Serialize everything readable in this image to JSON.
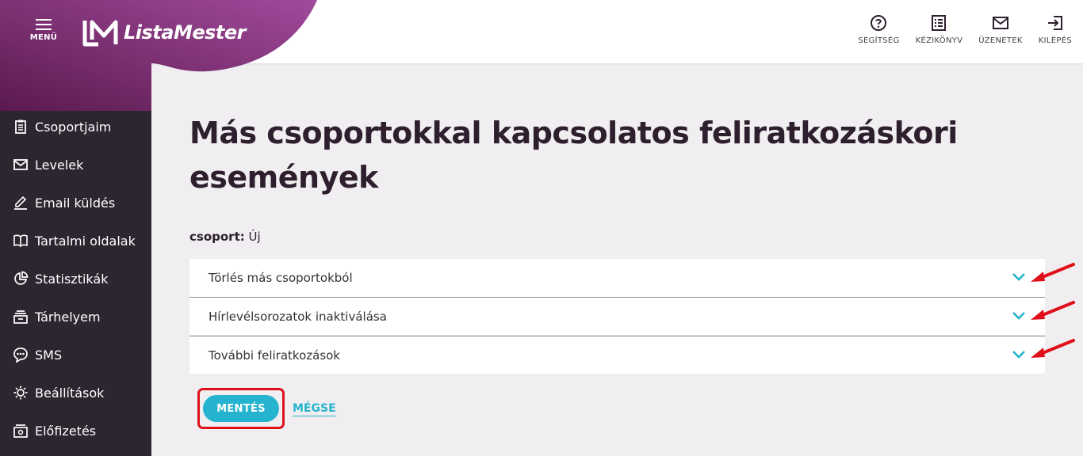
{
  "header": {
    "menu_label": "MENÜ",
    "logo_text": "ListaMester",
    "actions": [
      {
        "label": "SEGÍTSÉG",
        "icon": "help-icon"
      },
      {
        "label": "KÉZIKÖNYV",
        "icon": "manual-icon"
      },
      {
        "label": "ÜZENETEK",
        "icon": "mail-icon"
      },
      {
        "label": "KILÉPÉS",
        "icon": "logout-icon"
      }
    ]
  },
  "sidebar": {
    "items": [
      {
        "label": "Csoportjaim",
        "icon": "clipboard-icon"
      },
      {
        "label": "Levelek",
        "icon": "envelope-icon"
      },
      {
        "label": "Email küldés",
        "icon": "pencil-icon"
      },
      {
        "label": "Tartalmi oldalak",
        "icon": "book-icon"
      },
      {
        "label": "Statisztikák",
        "icon": "pie-chart-icon"
      },
      {
        "label": "Tárhelyem",
        "icon": "storage-icon"
      },
      {
        "label": "SMS",
        "icon": "sms-icon"
      },
      {
        "label": "Beállítások",
        "icon": "gear-icon"
      },
      {
        "label": "Előfizetés",
        "icon": "subscription-icon"
      }
    ]
  },
  "main": {
    "title_line1": "Más csoportokkal kapcsolatos feliratkozáskori",
    "title_line2": "események",
    "group_label": "csoport:",
    "group_value": "Új",
    "sections": [
      {
        "label": "Törlés más csoportokból"
      },
      {
        "label": "Hírlevélsorozatok inaktiválása"
      },
      {
        "label": "További feliratkozások"
      }
    ],
    "save_label": "MENTÉS",
    "cancel_label": "MÉGSE"
  },
  "colors": {
    "accent": "#26b3cf",
    "sidebar_bg": "#2d2630",
    "brand_gradient_start": "#5a1a4e",
    "brand_gradient_end": "#a24a9c",
    "annotation_red": "#e0101b"
  }
}
